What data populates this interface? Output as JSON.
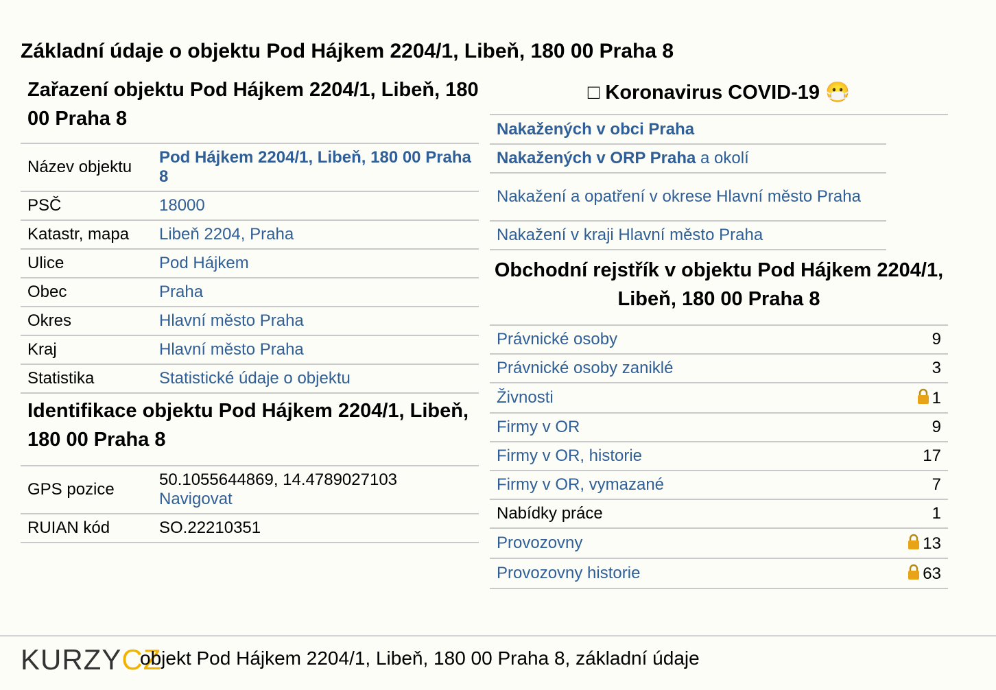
{
  "page_title": "Základní údaje o objektu Pod Hájkem 2204/1, Libeň, 180 00 Praha 8",
  "classification": {
    "title": "Zařazení objektu Pod Hájkem 2204/1, Libeň, 180 00 Praha 8",
    "rows": {
      "name": {
        "label": "Název objektu",
        "value": "Pod Hájkem 2204/1, Libeň, 180 00 Praha 8"
      },
      "psc": {
        "label": "PSČ",
        "value": "18000"
      },
      "cadastre": {
        "label": "Katastr, mapa",
        "value": "Libeň 2204, Praha"
      },
      "street": {
        "label": "Ulice",
        "value": "Pod Hájkem"
      },
      "municipality": {
        "label": "Obec",
        "value": "Praha"
      },
      "district": {
        "label": "Okres",
        "value": "Hlavní město Praha"
      },
      "region": {
        "label": "Kraj",
        "value": "Hlavní město Praha"
      },
      "stats": {
        "label": "Statistika",
        "value": "Statistické údaje o objektu"
      }
    }
  },
  "identification": {
    "title": "Identifikace objektu Pod Hájkem 2204/1, Libeň, 180 00 Praha 8",
    "gps": {
      "label": "GPS pozice",
      "value": "50.1055644869, 14.4789027103",
      "link": "Navigovat"
    },
    "ruian": {
      "label": "RUIAN kód",
      "value": "SO.22210351"
    }
  },
  "covid": {
    "title_icon": "□",
    "title": "Koronavirus COVID-19",
    "mask_icon": "😷",
    "links": {
      "l1": "Nakažených v obci Praha",
      "l2_bold": "Nakažených v ORP Praha",
      "l2_rest": " a okolí",
      "l3": "Nakažení a opatření v okrese Hlavní město Praha",
      "l4": "Nakažení v kraji Hlavní město Praha"
    }
  },
  "register": {
    "title": "Obchodní rejstřík v objektu Pod Hájkem 2204/1, Libeň, 180 00 Praha 8",
    "rows": [
      {
        "label": "Právnické osoby",
        "count": "9"
      },
      {
        "label": "Právnické osoby zaniklé",
        "count": "3"
      },
      {
        "label": "Živnosti",
        "count": "1"
      },
      {
        "label": "Firmy v OR",
        "count": "9"
      },
      {
        "label": "Firmy v OR, historie",
        "count": "17"
      },
      {
        "label": "Firmy v OR, vymazané",
        "count": "7"
      },
      {
        "label": "Nabídky práce",
        "count": "1"
      },
      {
        "label": "Provozovny",
        "count": "13"
      },
      {
        "label": "Provozovny historie",
        "count": "63"
      }
    ]
  },
  "footer": {
    "logo_part1": "KURZY",
    "logo_part2": "CZ",
    "text": "objekt Pod Hájkem 2204/1, Libeň, 180 00 Praha 8, základní údaje"
  },
  "colors": {
    "link": "#2f5f96",
    "lock": "#e8a317",
    "logo_accent": "#f0b400"
  }
}
